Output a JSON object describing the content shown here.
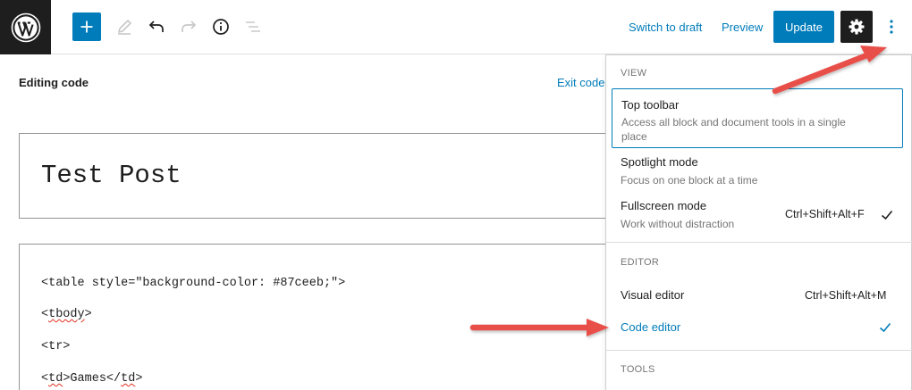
{
  "header": {
    "logo": "wordpress-logo",
    "add_block_icon": "plus-icon",
    "tools": [
      "pencil-icon",
      "undo-icon",
      "redo-icon",
      "info-icon",
      "list-view-icon"
    ],
    "switch_to_draft": "Switch to draft",
    "preview": "Preview",
    "update": "Update",
    "settings_icon": "gear-icon",
    "more_icon": "vertical-ellipsis-icon"
  },
  "editor": {
    "mode_label": "Editing code",
    "exit_code": "Exit code",
    "title": "Test Post",
    "code_lines": [
      "<table style=\"background-color: #87ceeb;\">",
      "<tbody>",
      "<tr>",
      "<td>Games</td>"
    ]
  },
  "menu": {
    "view_heading": "VIEW",
    "view_items": [
      {
        "label": "Top toolbar",
        "desc": "Access all block and document tools in a single place",
        "shortcut": "",
        "checked": false
      },
      {
        "label": "Spotlight mode",
        "desc": "Focus on one block at a time",
        "shortcut": "",
        "checked": false
      },
      {
        "label": "Fullscreen mode",
        "desc": "Work without distraction",
        "shortcut": "Ctrl+Shift+Alt+F",
        "checked": true
      }
    ],
    "editor_heading": "EDITOR",
    "editor_items": [
      {
        "label": "Visual editor",
        "shortcut": "Ctrl+Shift+Alt+M",
        "checked": false
      },
      {
        "label": "Code editor",
        "shortcut": "",
        "checked": true
      }
    ],
    "tools_heading": "TOOLS"
  },
  "colors": {
    "accent": "#007cba",
    "dark": "#1e1e1e",
    "muted": "#757575",
    "annotation_arrow": "#e8504a"
  }
}
